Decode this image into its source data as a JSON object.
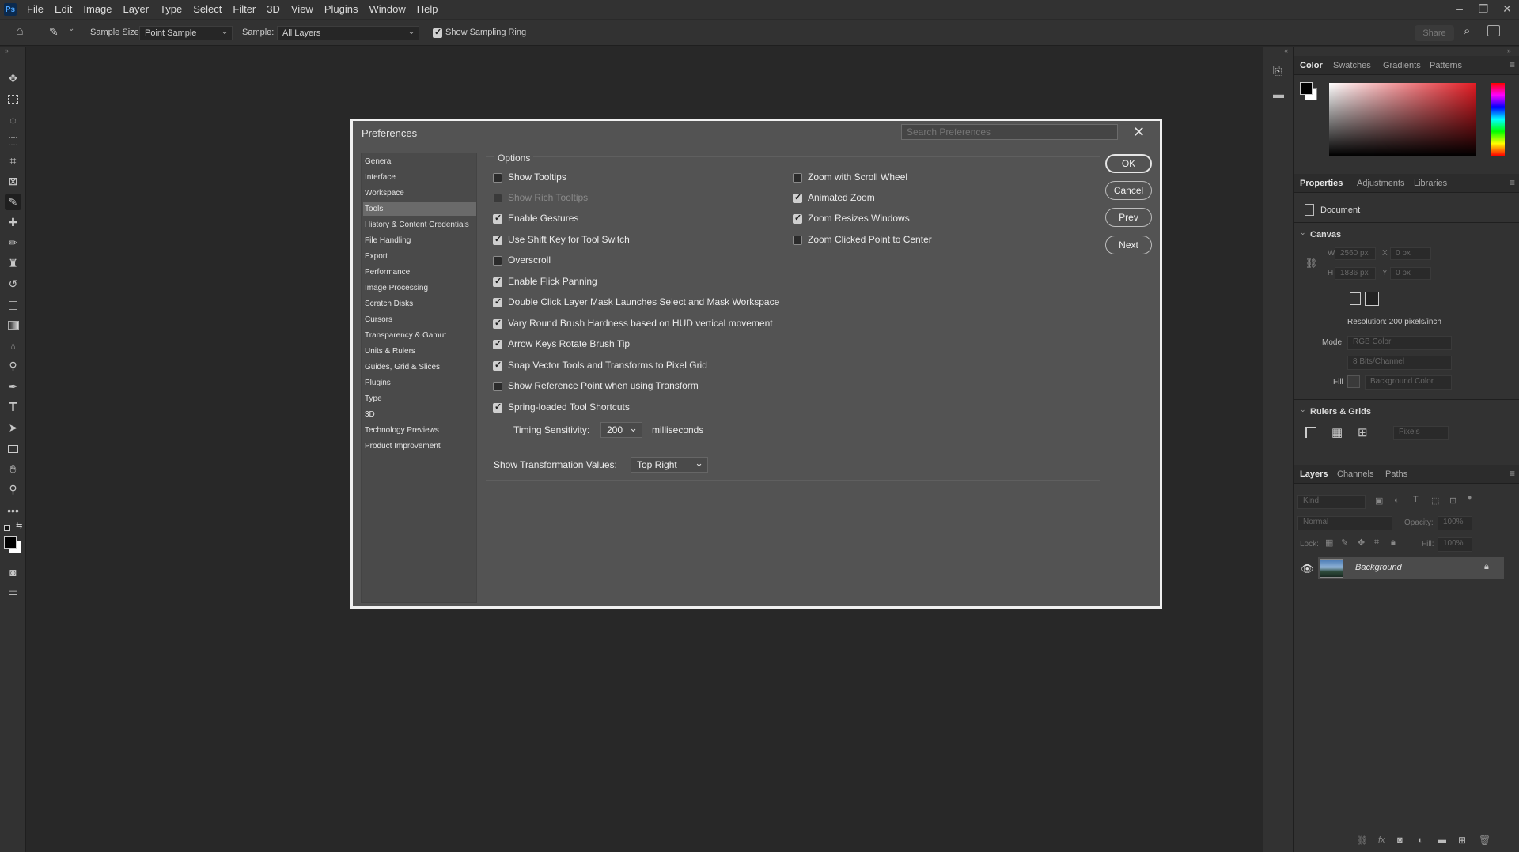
{
  "app": {
    "logo": "Ps"
  },
  "menu": [
    "File",
    "Edit",
    "Image",
    "Layer",
    "Type",
    "Select",
    "Filter",
    "3D",
    "View",
    "Plugins",
    "Window",
    "Help"
  ],
  "window_controls": [
    "–",
    "❐",
    "✕"
  ],
  "options_bar": {
    "sample_size_label": "Sample Size:",
    "sample_size_value": "Point Sample",
    "sample_label": "Sample:",
    "sample_value": "All Layers",
    "show_sampling_ring_label": "Show Sampling Ring",
    "show_sampling_ring_checked": true,
    "share_label": "Share"
  },
  "dialog": {
    "title": "Preferences",
    "search_placeholder": "Search Preferences",
    "nav": [
      "General",
      "Interface",
      "Workspace",
      "Tools",
      "History & Content Credentials",
      "File Handling",
      "Export",
      "Performance",
      "Image Processing",
      "Scratch Disks",
      "Cursors",
      "Transparency & Gamut",
      "Units & Rulers",
      "Guides, Grid & Slices",
      "Plugins",
      "Type",
      "3D",
      "Technology Previews",
      "Product Improvement"
    ],
    "nav_selected": "Tools",
    "options_title": "Options",
    "left_options": [
      {
        "label": "Show Tooltips",
        "checked": false,
        "disabled": false
      },
      {
        "label": "Show Rich Tooltips",
        "checked": false,
        "disabled": true
      },
      {
        "label": "Enable Gestures",
        "checked": true,
        "disabled": false
      },
      {
        "label": "Use Shift Key for Tool Switch",
        "checked": true,
        "disabled": false
      },
      {
        "label": "Overscroll",
        "checked": false,
        "disabled": false
      },
      {
        "label": "Enable Flick Panning",
        "checked": true,
        "disabled": false
      },
      {
        "label": "Double Click Layer Mask Launches Select and Mask Workspace",
        "checked": true,
        "disabled": false
      },
      {
        "label": "Vary Round Brush Hardness based on HUD vertical movement",
        "checked": true,
        "disabled": false
      },
      {
        "label": "Arrow Keys Rotate Brush Tip",
        "checked": true,
        "disabled": false
      },
      {
        "label": "Snap Vector Tools and Transforms to Pixel Grid",
        "checked": true,
        "disabled": false
      },
      {
        "label": "Show Reference Point when using Transform",
        "checked": false,
        "disabled": false
      },
      {
        "label": "Spring-loaded Tool Shortcuts",
        "checked": true,
        "disabled": false
      }
    ],
    "right_options": [
      {
        "label": "Zoom with Scroll Wheel",
        "checked": false
      },
      {
        "label": "Animated Zoom",
        "checked": true
      },
      {
        "label": "Zoom Resizes Windows",
        "checked": true
      },
      {
        "label": "Zoom Clicked Point to Center",
        "checked": false
      }
    ],
    "timing_label": "Timing Sensitivity:",
    "timing_value": "200",
    "timing_unit": "milliseconds",
    "transform_label": "Show Transformation Values:",
    "transform_value": "Top Right",
    "buttons": {
      "ok": "OK",
      "cancel": "Cancel",
      "prev": "Prev",
      "next": "Next"
    }
  },
  "color_panel": {
    "tabs": [
      "Color",
      "Swatches",
      "Gradients",
      "Patterns"
    ],
    "selected": "Color"
  },
  "properties_panel": {
    "tabs": [
      "Properties",
      "Adjustments",
      "Libraries"
    ],
    "selected": "Properties",
    "doc_label": "Document",
    "canvas_label": "Canvas",
    "w_label": "W",
    "w_value": "2560 px",
    "h_label": "H",
    "h_value": "1836 px",
    "x_label": "X",
    "x_value": "0 px",
    "y_label": "Y",
    "y_value": "0 px",
    "resolution": "Resolution: 200 pixels/inch",
    "mode_label": "Mode",
    "mode_value": "RGB Color",
    "bits_value": "8 Bits/Channel",
    "fill_label": "Fill",
    "fill_value": "Background Color",
    "rulers_label": "Rulers & Grids",
    "units_value": "Pixels"
  },
  "layers_panel": {
    "tabs": [
      "Layers",
      "Channels",
      "Paths"
    ],
    "selected": "Layers",
    "kind_placeholder": "Kind",
    "blend_mode": "Normal",
    "opacity_label": "Opacity:",
    "opacity_value": "100%",
    "lock_label": "Lock:",
    "fill_label": "Fill:",
    "fill_value": "100%",
    "layer_name": "Background"
  }
}
